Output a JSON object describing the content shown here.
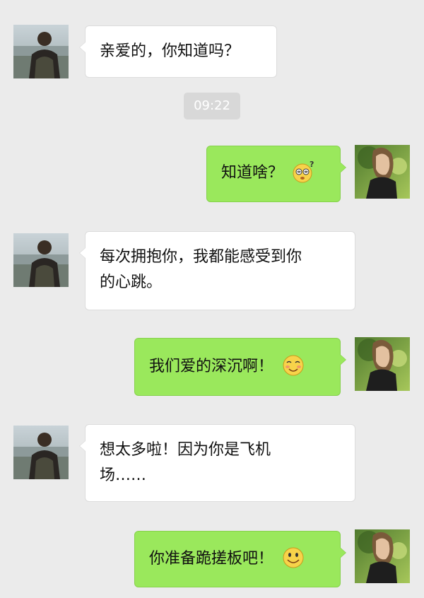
{
  "messages": [
    {
      "side": "left",
      "text": "亲爱的，你知道吗？"
    },
    {
      "side": "right",
      "text": "知道啥？",
      "emoji": "dizzy-question-face-icon"
    },
    {
      "side": "left",
      "text_lines": [
        "每次拥抱你，我都能感受到你",
        "的心跳。"
      ]
    },
    {
      "side": "right",
      "text": "我们爱的深沉啊！",
      "emoji": "shy-smile-face-icon"
    },
    {
      "side": "left",
      "text_lines": [
        "想太多啦！因为你是飞机",
        "场……"
      ]
    },
    {
      "side": "right",
      "text": "你准备跪搓板吧！",
      "emoji": "smile-face-icon"
    }
  ],
  "timestamp": "09:22",
  "colors": {
    "background": "#ebebeb",
    "bubble_in": "#ffffff",
    "bubble_out": "#9ae85c",
    "timestamp_bg": "#d8d8d8"
  }
}
